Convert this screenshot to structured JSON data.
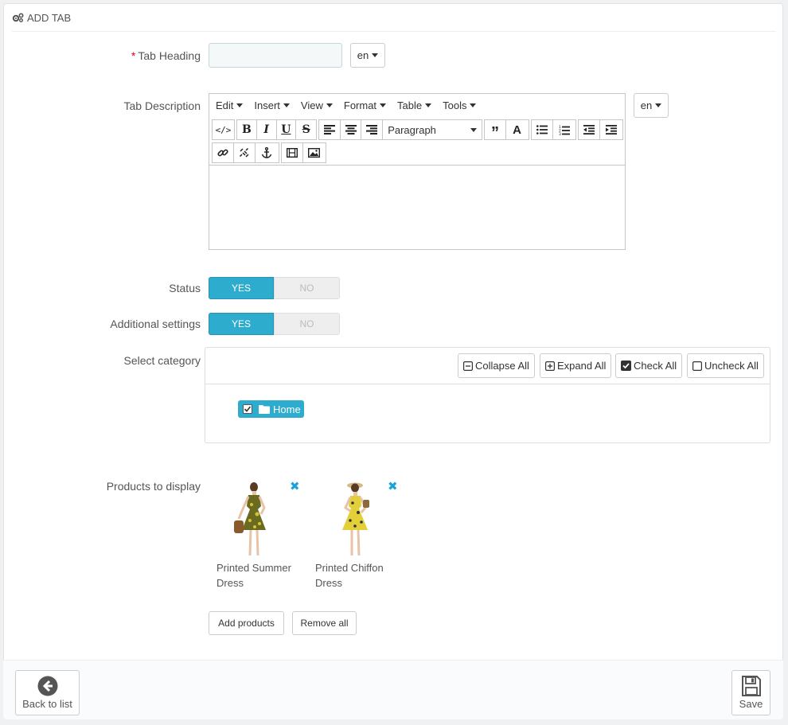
{
  "panel": {
    "title": "ADD TAB"
  },
  "form": {
    "tab_heading": {
      "label": "Tab Heading",
      "required_mark": "*",
      "value": "",
      "lang": "en"
    },
    "tab_description": {
      "label": "Tab Description",
      "lang": "en",
      "menus": [
        "Edit",
        "Insert",
        "View",
        "Format",
        "Table",
        "Tools"
      ],
      "block_format": "Paragraph"
    },
    "status": {
      "label": "Status",
      "yes": "YES",
      "no": "NO",
      "value": "YES"
    },
    "additional": {
      "label": "Additional settings",
      "yes": "YES",
      "no": "NO",
      "value": "YES"
    },
    "category": {
      "label": "Select category",
      "collapse_all": "Collapse All",
      "expand_all": "Expand All",
      "check_all": "Check All",
      "uncheck_all": "Uncheck All",
      "root": {
        "name": "Home",
        "checked": true
      }
    },
    "products": {
      "label": "Products to display",
      "items": [
        {
          "name": "Printed Summer Dress"
        },
        {
          "name": "Printed Chiffon Dress"
        }
      ],
      "add_label": "Add products",
      "remove_all_label": "Remove all"
    }
  },
  "footer": {
    "back_label": "Back to list",
    "save_label": "Save"
  },
  "colors": {
    "accent": "#2eacce",
    "remove": "#1aa3d9",
    "required": "#e00000"
  }
}
